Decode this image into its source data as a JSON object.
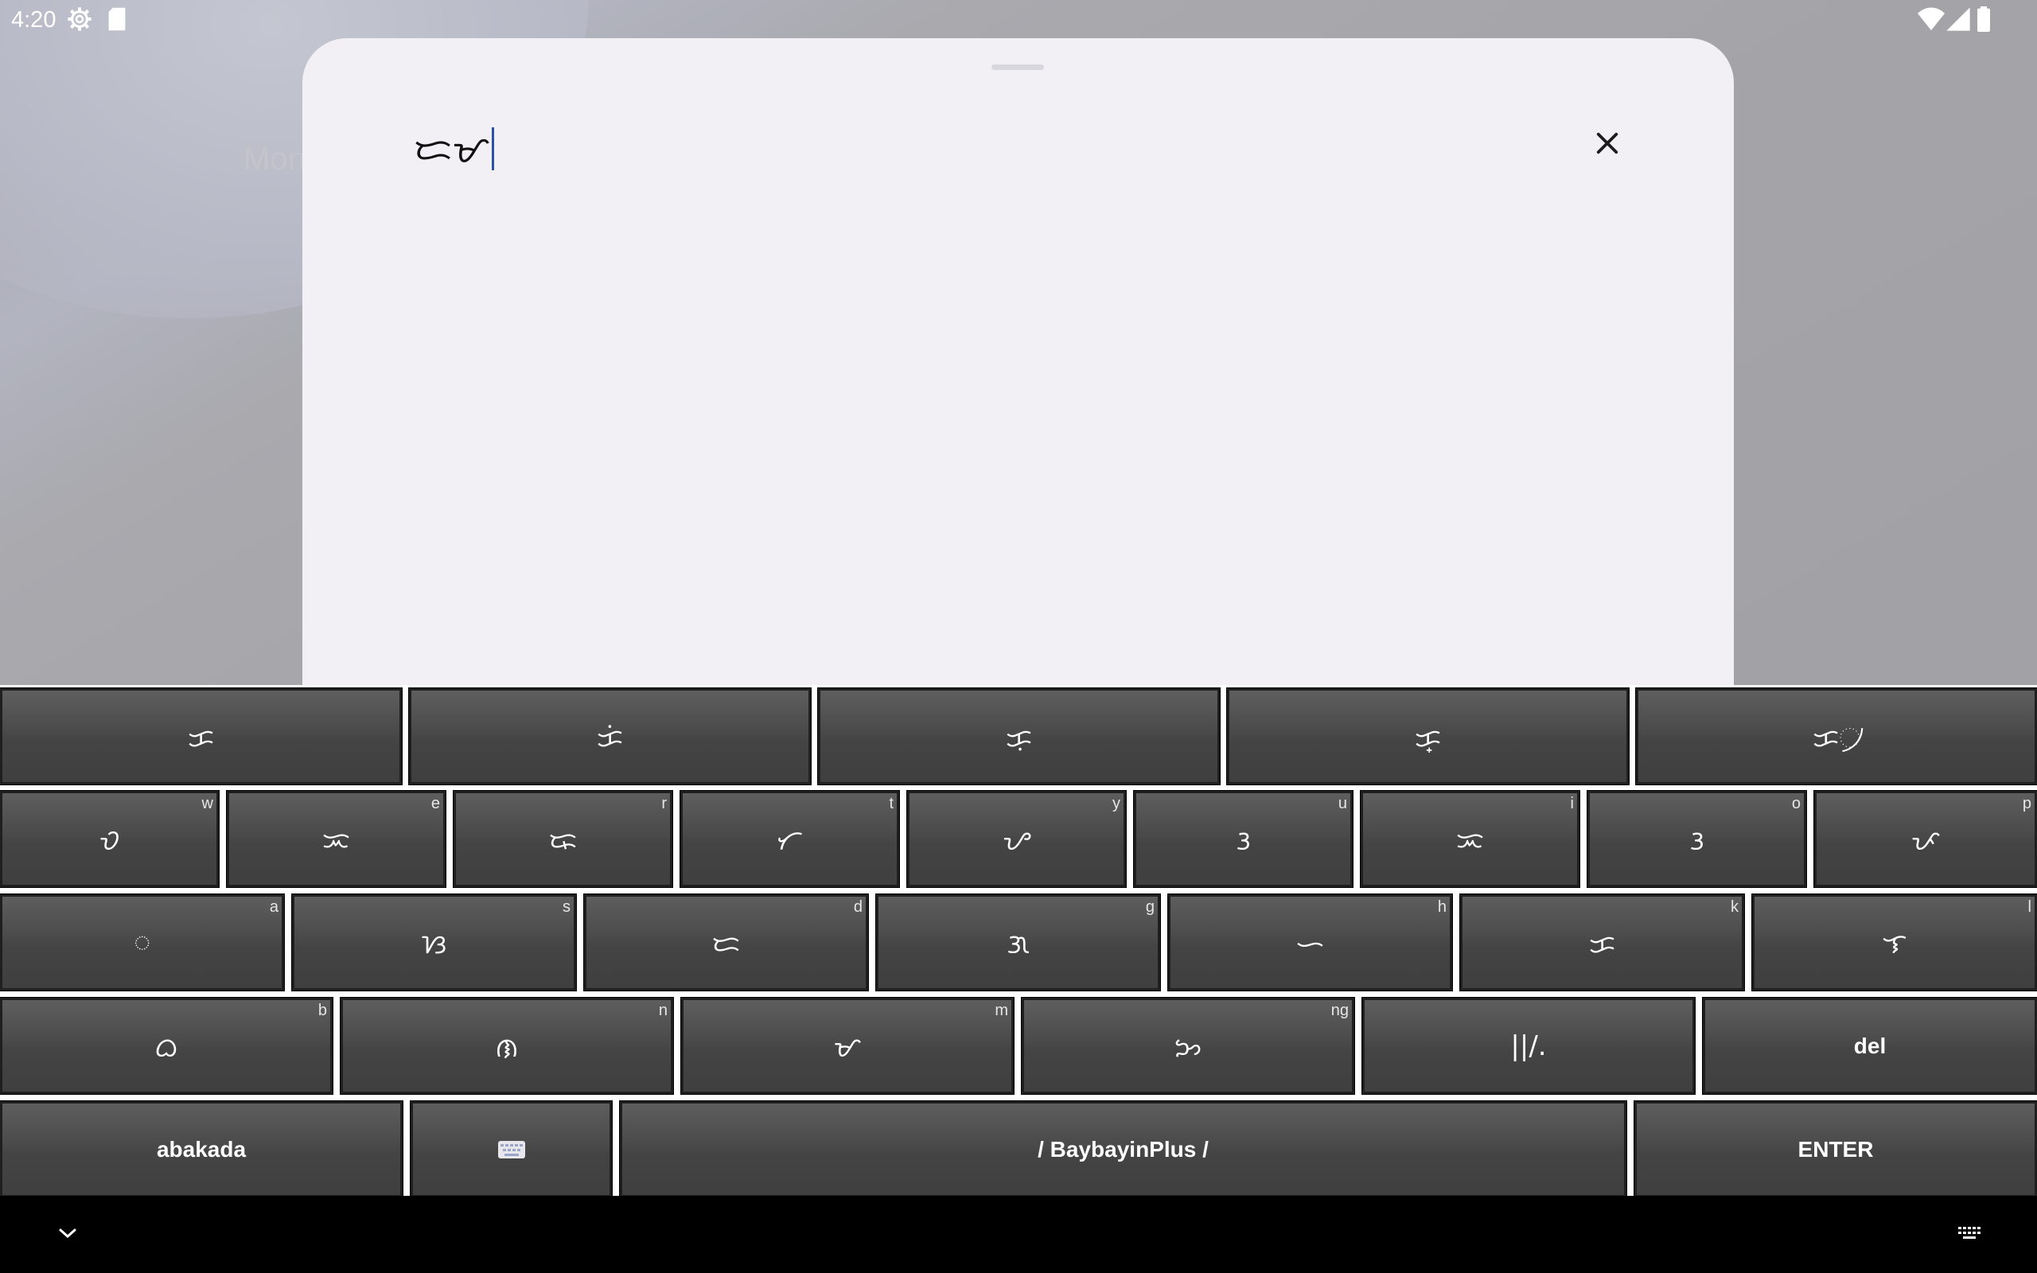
{
  "status_bar": {
    "time": "4:20",
    "left_icons": [
      "settings-gear-icon",
      "sd-card-icon"
    ],
    "right_icons": [
      "wifi-icon",
      "cell-signal-icon",
      "battery-icon"
    ]
  },
  "background": {
    "partial_label": "Mon"
  },
  "search_sheet": {
    "query_text": "ᜇᜋ",
    "close_icon": "close-icon"
  },
  "keyboard": {
    "row1": [
      {
        "key": "ᜃ"
      },
      {
        "key": "ᜃᜒ"
      },
      {
        "key": "ᜃᜓ"
      },
      {
        "key": "ᜃ᜔"
      },
      {
        "key": "ᜃ᜴"
      }
    ],
    "row2": [
      {
        "key": "ᜏ",
        "hint": "w"
      },
      {
        "key": "ᜁ",
        "hint": "e"
      },
      {
        "key": "ᜍ",
        "hint": "r"
      },
      {
        "key": "ᜆ",
        "hint": "t"
      },
      {
        "key": "ᜌ",
        "hint": "y"
      },
      {
        "key": "ᜂ",
        "hint": "u"
      },
      {
        "key": "ᜁ",
        "hint": "i"
      },
      {
        "key": "ᜂ",
        "hint": "o"
      },
      {
        "key": "ᜉ",
        "hint": "p"
      }
    ],
    "row3": [
      {
        "key": "ᜀ",
        "hint": "a"
      },
      {
        "key": "ᜐ",
        "hint": "s"
      },
      {
        "key": "ᜇ",
        "hint": "d"
      },
      {
        "key": "ᜄ",
        "hint": "g"
      },
      {
        "key": "ᜑ",
        "hint": "h"
      },
      {
        "key": "ᜃ",
        "hint": "k"
      },
      {
        "key": "ᜎ",
        "hint": "l"
      }
    ],
    "row4": [
      {
        "key": "ᜊ",
        "hint": "b"
      },
      {
        "key": "ᜈ",
        "hint": "n"
      },
      {
        "key": "ᜋ",
        "hint": "m"
      },
      {
        "key": "ᜅ",
        "hint": "ng"
      },
      {
        "key": "||/."
      },
      {
        "key": "del"
      }
    ],
    "row5": {
      "mode": "abakada",
      "switch_keyboard_icon": "keyboard-icon",
      "space": "/ BaybayinPlus /",
      "enter": "ENTER"
    }
  },
  "nav_bar": {
    "left_icon": "chevron-down-icon",
    "right_icon": "keyboard-switch-icon"
  }
}
